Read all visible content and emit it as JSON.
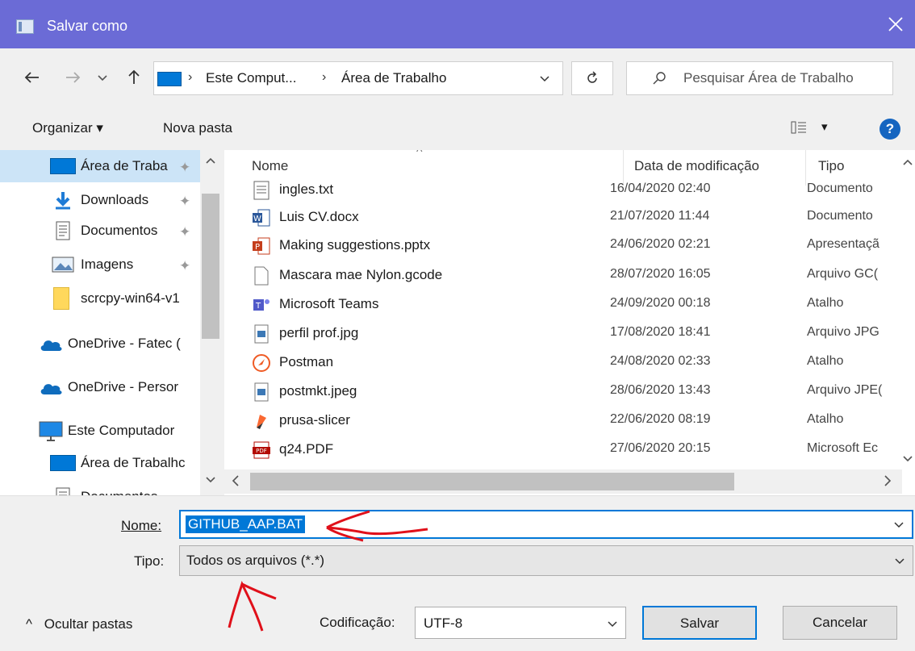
{
  "window": {
    "title": "Salvar como",
    "close_glyph": "✕"
  },
  "nav": {
    "back_glyph": "←",
    "forward_glyph": "→",
    "recent_glyph": "⌄",
    "up_glyph": "↑",
    "breadcrumbs": [
      "Este Comput...",
      "Área de Trabalho"
    ],
    "breadcrumb_separator": "›",
    "dropdown_glyph": "⌄",
    "refresh_glyph": "↻",
    "search_placeholder": "Pesquisar Área de Trabalho"
  },
  "toolbar": {
    "organize_label": "Organizar ▾",
    "new_folder_label": "Nova pasta",
    "view_glyph": "▾",
    "help_glyph": "?"
  },
  "sidebar": {
    "items": [
      {
        "label": "Área de Traba",
        "icon": "desktop-icon",
        "pinned": true,
        "selected": true
      },
      {
        "label": "Downloads",
        "icon": "download-icon",
        "pinned": true
      },
      {
        "label": "Documentos",
        "icon": "document-icon",
        "pinned": true
      },
      {
        "label": "Imagens",
        "icon": "image-icon",
        "pinned": true
      },
      {
        "label": "scrcpy-win64-v1",
        "icon": "folder-icon"
      },
      {
        "label": "OneDrive - Fatec (",
        "icon": "cloud-icon"
      },
      {
        "label": "OneDrive - Persor",
        "icon": "cloud-icon"
      },
      {
        "label": "Este Computador",
        "icon": "computer-icon"
      },
      {
        "label": "Área de Trabalhc",
        "icon": "desktop-icon"
      },
      {
        "label": "Documentos",
        "icon": "document-icon"
      }
    ],
    "pin_glyph": "✦"
  },
  "files": {
    "columns": {
      "name": "Nome",
      "date": "Data de modificação",
      "type": "Tipo"
    },
    "sort_glyph": "^",
    "rows": [
      {
        "name": "ingles.txt",
        "date": "16/04/2020 02:40",
        "type": "Documento",
        "icon": "text-file-icon"
      },
      {
        "name": "Luis CV.docx",
        "date": "21/07/2020 11:44",
        "type": "Documento",
        "icon": "word-icon"
      },
      {
        "name": "Making suggestions.pptx",
        "date": "24/06/2020 02:21",
        "type": "Apresentaçã",
        "icon": "powerpoint-icon"
      },
      {
        "name": "Mascara mae Nylon.gcode",
        "date": "28/07/2020 16:05",
        "type": "Arquivo GC(",
        "icon": "blank-file-icon"
      },
      {
        "name": "Microsoft Teams",
        "date": "24/09/2020 00:18",
        "type": "Atalho",
        "icon": "teams-icon"
      },
      {
        "name": "perfil prof.jpg",
        "date": "17/08/2020 18:41",
        "type": "Arquivo JPG",
        "icon": "image-file-icon"
      },
      {
        "name": "Postman",
        "date": "24/08/2020 02:33",
        "type": "Atalho",
        "icon": "postman-icon"
      },
      {
        "name": "postmkt.jpeg",
        "date": "28/06/2020 13:43",
        "type": "Arquivo JPE(",
        "icon": "image-file-icon"
      },
      {
        "name": "prusa-slicer",
        "date": "22/06/2020 08:19",
        "type": "Atalho",
        "icon": "prusa-icon"
      },
      {
        "name": "q24.PDF",
        "date": "27/06/2020 20:15",
        "type": "Microsoft Ec",
        "icon": "pdf-icon"
      }
    ]
  },
  "form": {
    "name_label": "Nome:",
    "name_value": "GITHUB_AAP.BAT",
    "type_label": "Tipo:",
    "type_value": "Todos os arquivos  (*.*)",
    "encoding_label": "Codificação:",
    "encoding_value": "UTF-8",
    "save_label": "Salvar",
    "cancel_label": "Cancelar",
    "hide_folders_label": "Ocultar pastas",
    "hide_glyph": "^"
  },
  "colors": {
    "titlebar": "#6b6bd6",
    "accent": "#0078d7",
    "annotation": "#e0101a"
  }
}
